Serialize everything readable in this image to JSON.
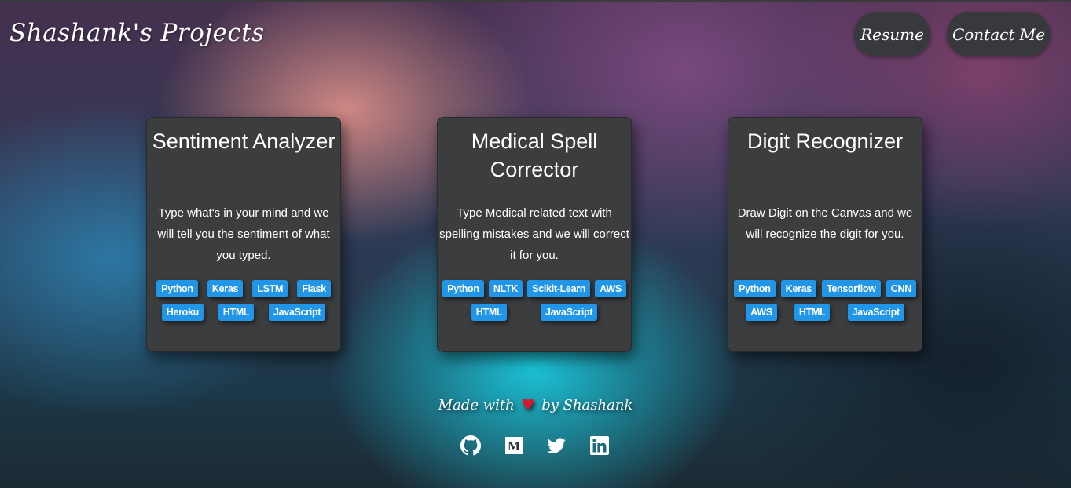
{
  "header": {
    "brand": "Shashank's Projects",
    "nav": {
      "resume": "Resume",
      "contact": "Contact Me"
    }
  },
  "projects": [
    {
      "title": "Sentiment Analyzer",
      "description": "Type what's in your mind and we will tell you the sentiment of what you typed.",
      "tag_rows": [
        [
          "Python",
          "Keras",
          "LSTM",
          "Flask"
        ],
        [
          "Heroku",
          "HTML",
          "JavaScript"
        ]
      ]
    },
    {
      "title": "Medical Spell Corrector",
      "description": "Type Medical related text with spelling mistakes and we will correct it for you.",
      "tag_rows": [
        [
          "Python",
          "NLTK",
          "Scikit-Learn",
          "AWS"
        ],
        [
          "HTML",
          "JavaScript"
        ]
      ]
    },
    {
      "title": "Digit Recognizer",
      "description": "Draw Digit on the Canvas and we will recognize the digit for you.",
      "tag_rows": [
        [
          "Python",
          "Keras",
          "Tensorflow",
          "CNN"
        ],
        [
          "AWS",
          "HTML",
          "JavaScript"
        ]
      ]
    }
  ],
  "footer": {
    "made_with": "Made with",
    "heart": "♥",
    "by": "by Shashank",
    "social_icons": [
      "github-icon",
      "medium-icon",
      "twitter-icon",
      "linkedin-icon"
    ]
  },
  "colors": {
    "card_bg": "#3c3d3f",
    "tag_bg": "#2196e9",
    "nav_bg": "#37393c",
    "heart": "#d9182b"
  }
}
